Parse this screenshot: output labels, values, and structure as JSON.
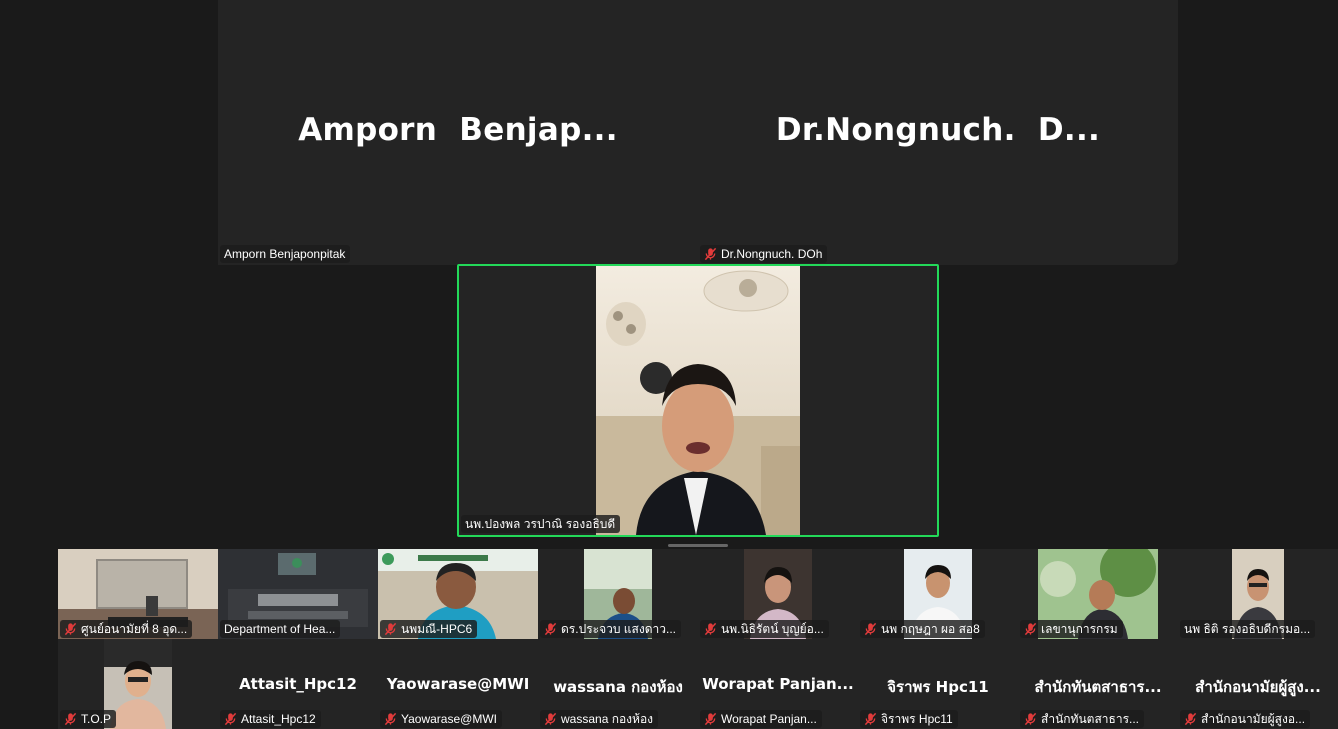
{
  "top_tiles": [
    {
      "display_name": "Amporn  Benjap...",
      "label": "Amporn Benjaponpitak",
      "muted": false
    },
    {
      "display_name": "Dr.Nongnuch.  D...",
      "label": "Dr.Nongnuch. DOh",
      "muted": true
    }
  ],
  "speaker": {
    "label": "นพ.ปองพล วรปาณิ รองอธิบดี",
    "muted": false,
    "border_color": "#23d959"
  },
  "row1": [
    {
      "label": "ศูนย์อนามัยที่ 8 อุด...",
      "muted": true,
      "video": "room"
    },
    {
      "label": "Department of Hea...",
      "muted": false,
      "video": "conference"
    },
    {
      "label": "นพมณี-HPC6",
      "muted": true,
      "video": "person-blue"
    },
    {
      "label": "ดร.ประจวบ แสงดาว...",
      "muted": true,
      "video": "person-window"
    },
    {
      "label": "นพ.นิธิรัตน์ บุญย์อ...",
      "muted": true,
      "video": "person-dark"
    },
    {
      "label": "นพ กฤษฎา ผอ สอ8",
      "muted": true,
      "video": "person-white"
    },
    {
      "label": "เลขานุการกรม",
      "muted": true,
      "video": "person-tree"
    },
    {
      "label": "นพ ธิติ รองอธิบดีกรมอ...",
      "muted": false,
      "video": "person-glasses"
    }
  ],
  "row2": [
    {
      "display_name": "",
      "label": "T.O.P",
      "muted": true,
      "video": "person-car"
    },
    {
      "display_name": "Attasit_Hpc12",
      "label": "Attasit_Hpc12",
      "muted": true
    },
    {
      "display_name": "Yaowarase@MWI",
      "label": "Yaowarase@MWI",
      "muted": true
    },
    {
      "display_name": "wassana กองห้อง",
      "label": "wassana กองห้อง",
      "muted": true
    },
    {
      "display_name": "Worapat  Panjan...",
      "label": "Worapat Panjan...",
      "muted": true
    },
    {
      "display_name": "จิราพร Hpc11",
      "label": "จิราพร Hpc11",
      "muted": true
    },
    {
      "display_name": "สำนักทันตสาธาร...",
      "label": "สำนักทันตสาธาร...",
      "muted": true
    },
    {
      "display_name": "สำนักอนามัยผู้สูง...",
      "label": "สำนักอนามัยผู้สูงอ...",
      "muted": true
    }
  ]
}
